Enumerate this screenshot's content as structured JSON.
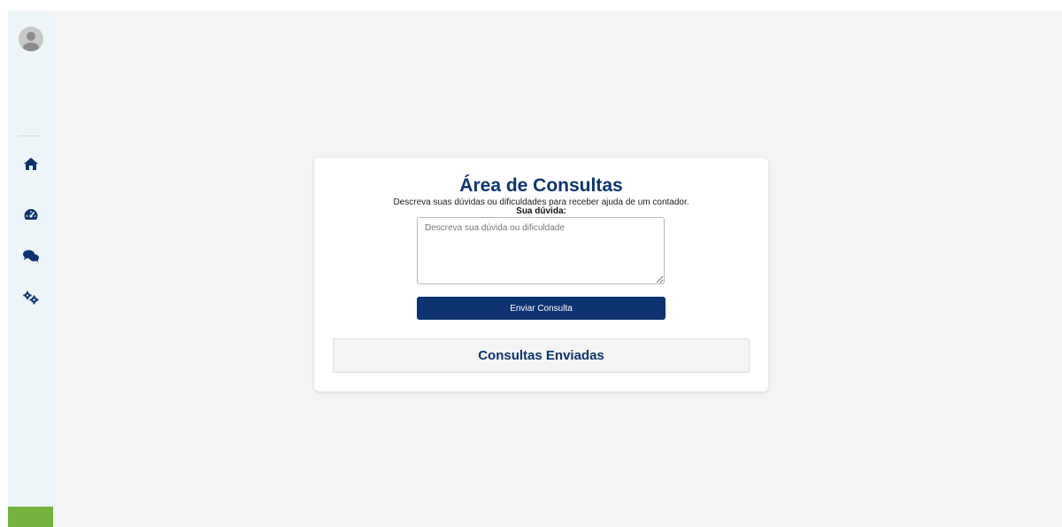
{
  "sidebar": {
    "icons": [
      "user-avatar-icon",
      "home-icon",
      "dashboard-icon",
      "chat-icon",
      "settings-icon"
    ]
  },
  "main": {
    "title": "Área de Consultas",
    "subtitle": "Descreva suas dúvidas ou dificuldades para receber ajuda de um contador.",
    "field_label": "Sua dúvida:",
    "question_placeholder": "Descreva sua dúvida ou dificuldade",
    "question_value": "",
    "send_label": "Enviar Consulta",
    "sent_section_title": "Consultas Enviadas"
  },
  "colors": {
    "primary": "#0d3471",
    "sidebar_bg": "#eef5f8",
    "page_bg": "#f4f4f4",
    "accent_green": "#73b33d"
  }
}
